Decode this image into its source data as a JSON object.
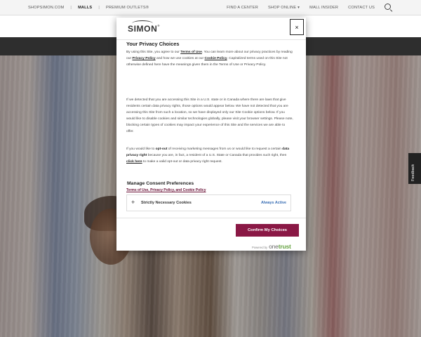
{
  "topbar": {
    "left": [
      "SHOPSIMON.COM",
      "MALLS",
      "PREMIUM OUTLETS®"
    ],
    "right": [
      "FIND A CENTER",
      "SHOP ONLINE",
      "MALL INSIDER",
      "CONTACT US"
    ]
  },
  "feedback": "Feedback",
  "modal": {
    "logo": "SIMON",
    "close": "×",
    "title": "Your Privacy Choices",
    "p1": {
      "a": "By using this Site, you agree to our ",
      "terms": "Terms of Use",
      "b": ". You can learn more about our privacy practices by reading our ",
      "privacy": "Privacy Policy",
      "c": " and how we use cookies at our ",
      "cookie": "Cookie Policy",
      "d": ". Capitalized terms used on this Site not otherwise defined here have the meanings given them in the Terms of Use or Privacy Policy."
    },
    "p2": "If we detected that you are accessing this Site in a U.S. state or in Canada where there are laws that give residents certain data privacy rights, those options would appear below. We have not detected that you are accessing this Site from such a location, so we have displayed only our Site Cookie options below. If you would like to disable cookies and similar technologies globally, please visit your browser settings. Please note, blocking certain types of cookies may impact your experience of this Site and the services we are able to offer.",
    "p3": {
      "a": "If you would like to ",
      "optout": "opt-out",
      "b": " of receiving marketing messages from us or would like to request a certain ",
      "right": "data privacy right",
      "c": " because you are, in fact, a resident of a U.S. State or Canada that provides such right, then ",
      "here": "click here",
      "d": " to make a valid opt-out or data privacy right request."
    },
    "link": "Terms of Use, Privacy Policy, and Cookie Policy",
    "consent_heading": "Manage Consent Preferences",
    "accordion": {
      "label": "Strictly Necessary Cookies",
      "status": "Always Active"
    },
    "confirm": "Confirm My Choices",
    "powered_by": "Powered by",
    "brand_a": "one",
    "brand_b": "trust"
  },
  "colors": {
    "accent": "#8a1845",
    "always_active": "#3a6fb5",
    "onetrust_green": "#68a444"
  }
}
